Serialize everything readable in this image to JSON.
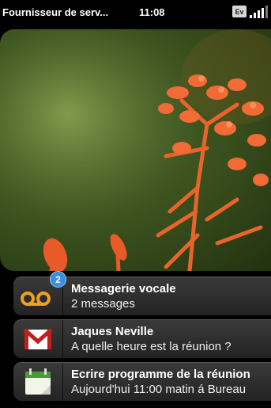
{
  "status": {
    "carrier": "Fournisseur de serv...",
    "time": "11:08",
    "network_badge": "Ev",
    "signal_level": 0.8
  },
  "notifications": [
    {
      "title": "Messagerie vocale",
      "subtitle": "2 messages",
      "icon": "voicemail-icon",
      "badge": "2"
    },
    {
      "title": "Jaques Neville",
      "subtitle": "A quelle heure est la réunion ?",
      "icon": "email-icon"
    },
    {
      "title": "Ecrire programme de la réunion",
      "subtitle": "Aujourd'hui 11:00 matin á Bureau",
      "icon": "calendar-icon"
    }
  ],
  "colors": {
    "accent": "#3c8ee0",
    "voicemail": "#f0a020",
    "mail_red": "#c0201c",
    "calendar_green": "#4a9a3a"
  }
}
